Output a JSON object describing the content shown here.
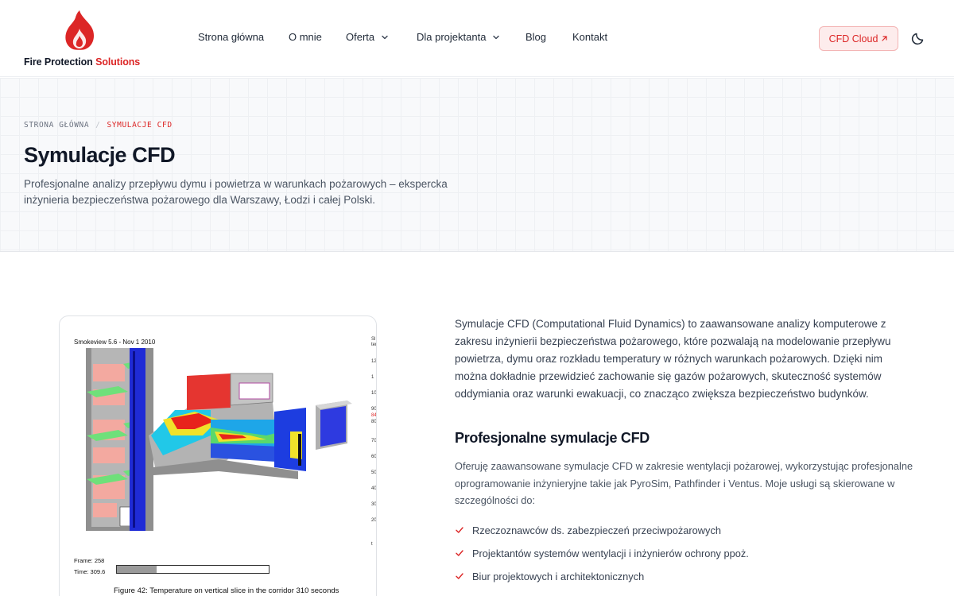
{
  "header": {
    "logo": {
      "name": "Fire Protection",
      "accent": "Solutions"
    },
    "nav": [
      {
        "label": "Strona główna",
        "has_dropdown": false
      },
      {
        "label": "O mnie",
        "has_dropdown": false
      },
      {
        "label": "Oferta",
        "has_dropdown": true
      },
      {
        "label": "Dla projektanta",
        "has_dropdown": true
      },
      {
        "label": "Blog",
        "has_dropdown": false
      },
      {
        "label": "Kontakt",
        "has_dropdown": false
      }
    ],
    "cta": {
      "label": "CFD Cloud",
      "icon": "external-arrow-icon"
    },
    "theme_toggle_icon": "moon-icon"
  },
  "hero": {
    "breadcrumb": [
      {
        "label": "STRONA GŁÓWNA"
      },
      {
        "label": "SYMULACJE CFD",
        "current": true
      }
    ],
    "breadcrumb_separator": "/",
    "title": "Symulacje CFD",
    "subtitle": "Profesjonalne analizy przepływu dymu i powietrza w warunkach pożarowych – ekspercka inżynieria bezpieczeństwa pożarowego dla Warszawy, Łodzi i całej Polski."
  },
  "figure": {
    "header": "Smokeview 5.6 - Nov  1 2010",
    "scale_labels": [
      "Sl",
      "tem",
      "12",
      "1",
      "10",
      "90",
      "84",
      "80",
      "70",
      "60",
      "50",
      "40",
      "30",
      "20",
      "t"
    ],
    "frame_text": "Frame: 258",
    "time_text": "Time: 309.6",
    "progress": 0.26,
    "caption": "Figure 42: Temperature on vertical slice in the corridor 310 seconds"
  },
  "content": {
    "intro": "Symulacje CFD (Computational Fluid Dynamics) to zaawansowane analizy komputerowe z zakresu inżynierii bezpieczeństwa pożarowego, które pozwalają na modelowanie przepływu powietrza, dymu oraz rozkładu temperatury w różnych warunkach pożarowych. Dzięki nim można dokładnie przewidzieć zachowanie się gazów pożarowych, skuteczność systemów oddymiania oraz warunki ewakuacji, co znacząco zwiększa bezpieczeństwo budynków.",
    "section_title": "Profesjonalne symulacje CFD",
    "section_text": "Oferuję zaawansowane symulacje CFD w zakresie wentylacji pożarowej, wykorzystując profesjonalne oprogramowanie inżynieryjne takie jak PyroSim, Pathfinder i Ventus. Moje usługi są skierowane w szczególności do:",
    "features": [
      "Rzeczoznawców ds. zabezpieczeń przeciwpożarowych",
      "Projektantów systemów wentylacji i inżynierów ochrony ppoż.",
      "Biur projektowych i architektonicznych"
    ]
  },
  "colors": {
    "accent": "#dc2626",
    "text": "#111827",
    "muted": "#4b5563",
    "cta_bg": "#fdecec"
  }
}
